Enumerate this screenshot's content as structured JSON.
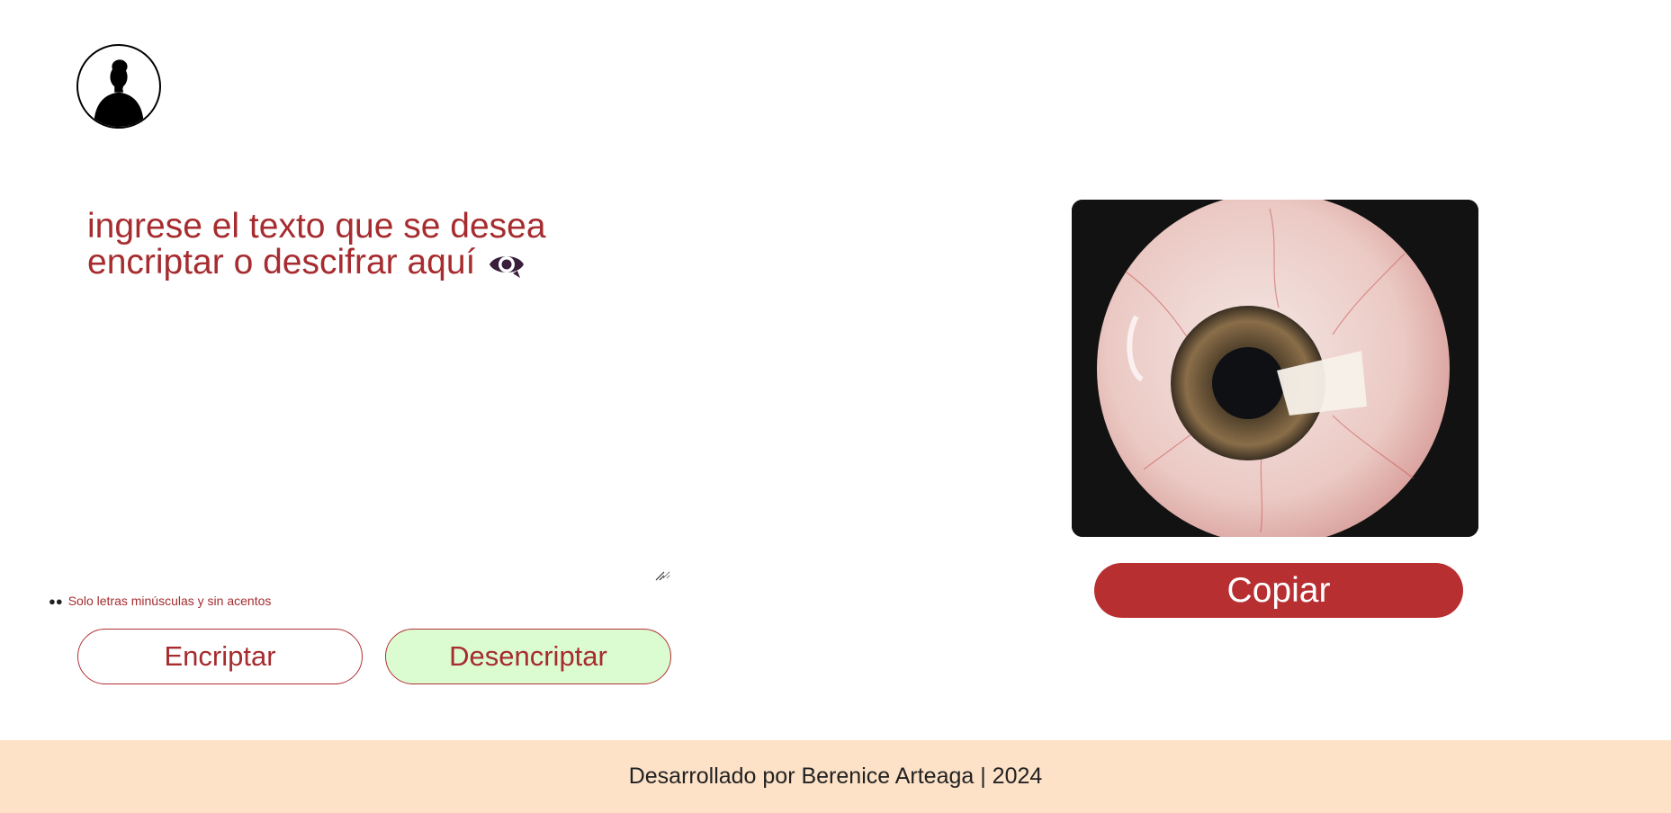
{
  "header": {
    "logo_icon": "woman-silhouette-icon"
  },
  "main": {
    "prompt_text": "ingrese el texto que se desea encriptar o descifrar aquí",
    "prompt_icon": "eye-icon",
    "input_value": "",
    "hint_icon": "eyes-emoji-icon",
    "hint_text": "Solo letras minúsculas y sin acentos",
    "encrypt_label": "Encriptar",
    "decrypt_label": "Desencriptar"
  },
  "result": {
    "image_icon": "eyeball-image",
    "copy_label": "Copiar"
  },
  "footer": {
    "text": "Desarrollado por Berenice Arteaga | 2024"
  },
  "colors": {
    "accent_red": "#a62c2f",
    "copy_button": "#b82f32",
    "decrypt_bg": "#dbfbd0",
    "footer_bg": "#fde2c8",
    "eye_icon": "#3a1f3d"
  }
}
